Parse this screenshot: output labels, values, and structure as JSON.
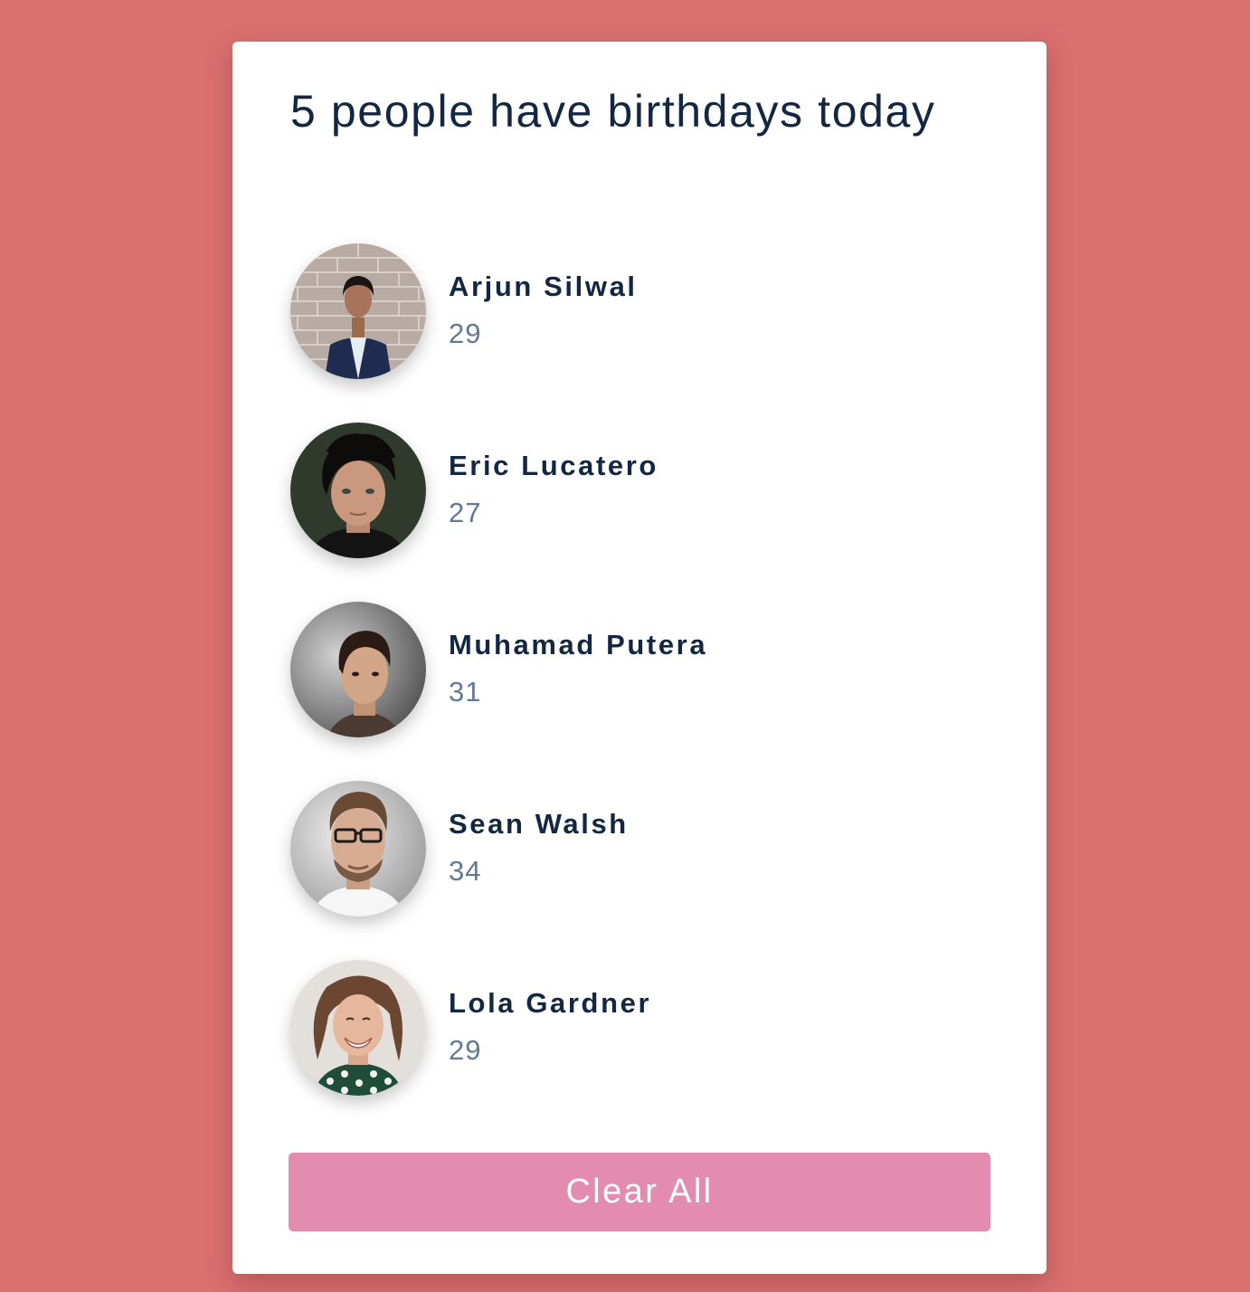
{
  "header": {
    "title": "5 people have birthdays today"
  },
  "people": [
    {
      "name": "Arjun Silwal",
      "age": "29"
    },
    {
      "name": "Eric Lucatero",
      "age": "27"
    },
    {
      "name": "Muhamad Putera",
      "age": "31"
    },
    {
      "name": "Sean Walsh",
      "age": "34"
    },
    {
      "name": "Lola Gardner",
      "age": "29"
    }
  ],
  "actions": {
    "clear_label": "Clear All"
  },
  "colors": {
    "background": "#d9706f",
    "card": "#ffffff",
    "heading": "#142742",
    "age": "#647894",
    "button": "#e48caf"
  }
}
